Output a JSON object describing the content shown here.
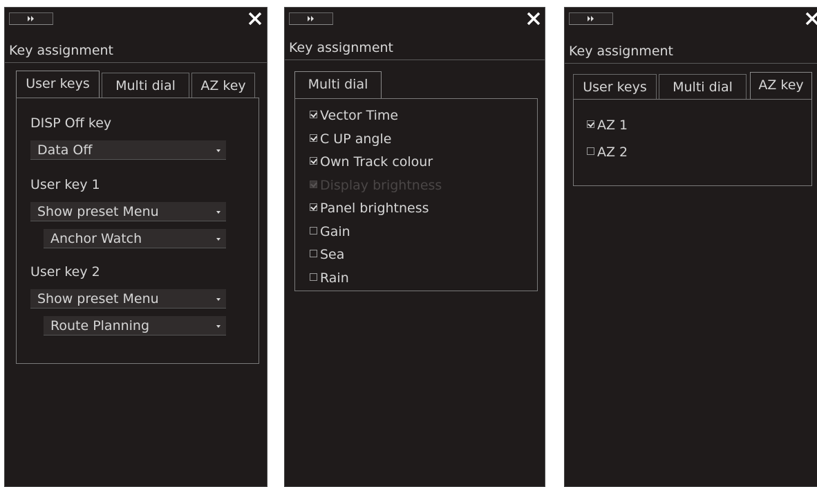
{
  "panels": [
    {
      "title": "Key assignment",
      "tabs": [
        "User keys",
        "Multi dial",
        "AZ key"
      ],
      "active_tab": "User keys",
      "disp_off": {
        "label": "DISP Off key",
        "value": "Data Off"
      },
      "user_key_1": {
        "label": "User key 1",
        "value": "Show preset Menu",
        "sub_value": "Anchor Watch"
      },
      "user_key_2": {
        "label": "User key 2",
        "value": "Show preset Menu",
        "sub_value": "Route Planning"
      }
    },
    {
      "title": "Key assignment",
      "tabs": [
        "Multi dial"
      ],
      "active_tab": "Multi dial",
      "options": [
        {
          "label": "Vector Time",
          "checked": true,
          "enabled": true
        },
        {
          "label": "C UP angle",
          "checked": true,
          "enabled": true
        },
        {
          "label": "Own Track colour",
          "checked": true,
          "enabled": true
        },
        {
          "label": "Display brightness",
          "checked": true,
          "enabled": false
        },
        {
          "label": "Panel brightness",
          "checked": true,
          "enabled": true
        },
        {
          "label": "Gain",
          "checked": false,
          "enabled": true
        },
        {
          "label": "Sea",
          "checked": false,
          "enabled": true
        },
        {
          "label": "Rain",
          "checked": false,
          "enabled": true
        }
      ]
    },
    {
      "title": "Key assignment",
      "tabs": [
        "User keys",
        "Multi dial",
        "AZ key"
      ],
      "active_tab": "AZ key",
      "options": [
        {
          "label": "AZ 1",
          "checked": true
        },
        {
          "label": "AZ 2",
          "checked": false
        }
      ]
    }
  ],
  "icons": {
    "expand": "double-chevron-right-icon",
    "close": "close-x-icon"
  },
  "colors": {
    "panel_bg": "#1f1b1b",
    "text": "#d6d6d6",
    "disabled_text": "#4a4646",
    "border": "#7a7a7a"
  }
}
